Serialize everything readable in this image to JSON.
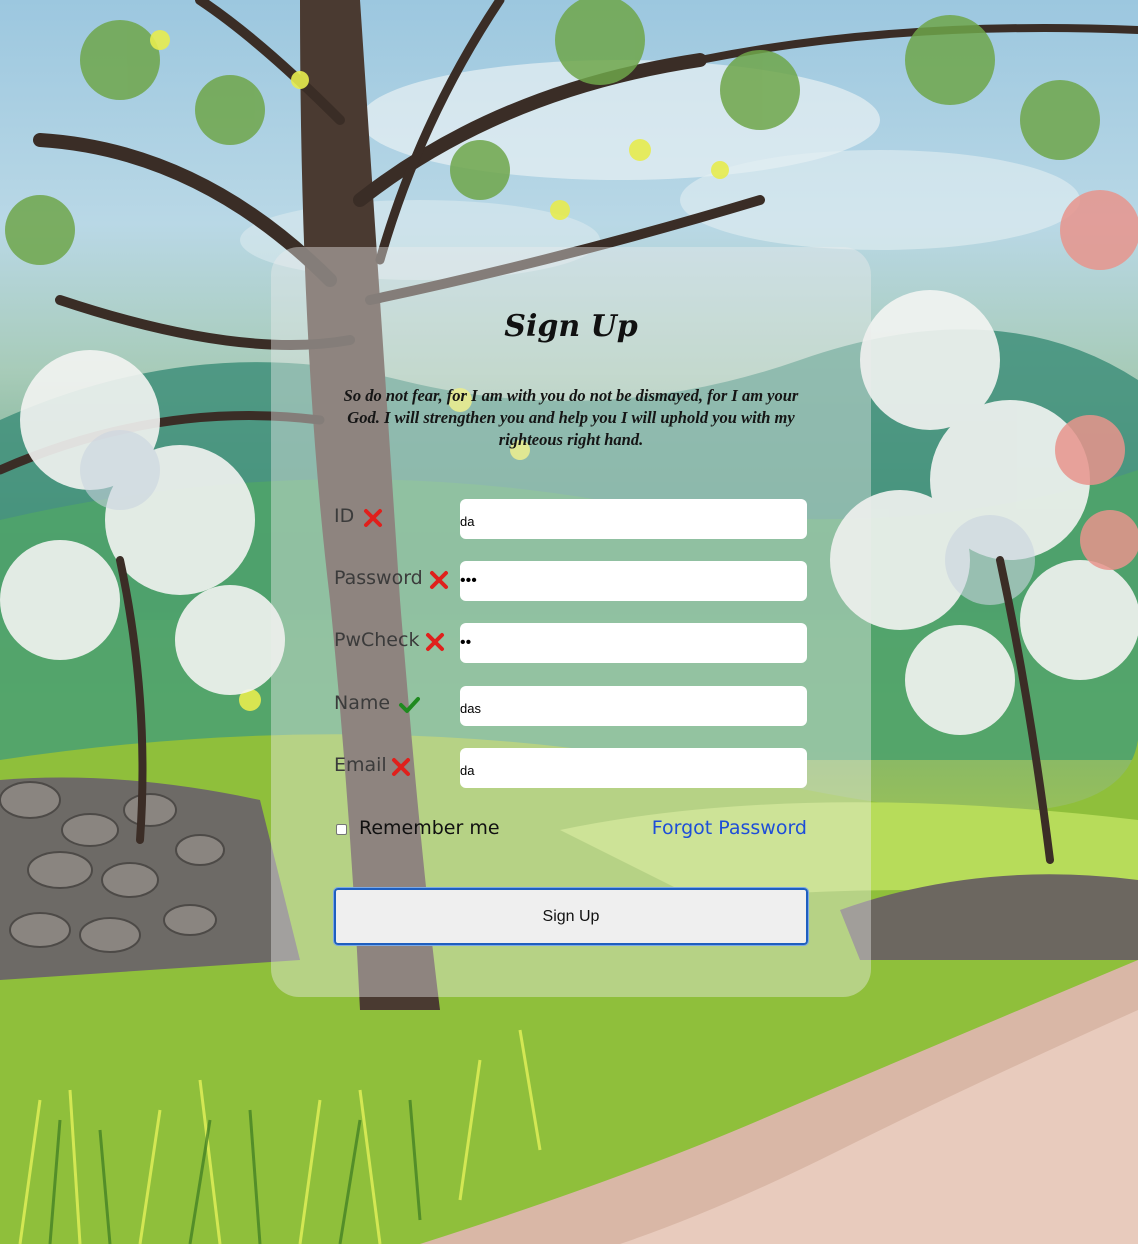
{
  "form": {
    "title": "Sign Up",
    "verse": "So do not fear, for I am with you do not be dismayed, for I am your God. I will strengthen you and help you I will uphold you with my righteous right hand.",
    "fields": [
      {
        "label": "ID",
        "value": "da",
        "status": "invalid",
        "type": "text"
      },
      {
        "label": "Password",
        "value": "•••",
        "status": "invalid",
        "type": "password"
      },
      {
        "label": "PwCheck",
        "value": "••",
        "status": "invalid",
        "type": "password"
      },
      {
        "label": "Name",
        "value": "das",
        "status": "valid",
        "type": "text"
      },
      {
        "label": "Email",
        "value": "da",
        "status": "invalid",
        "type": "text"
      }
    ],
    "remember_label": "Remember me",
    "remember_checked": false,
    "forgot_label": "Forgot Password",
    "submit_label": "Sign Up"
  },
  "colors": {
    "invalid": "#e0201c",
    "valid": "#1f8a1f",
    "link": "#1d4ed8",
    "button_border": "#1f5fbf"
  },
  "icons": {
    "invalid": "cross-icon",
    "valid": "check-icon"
  }
}
